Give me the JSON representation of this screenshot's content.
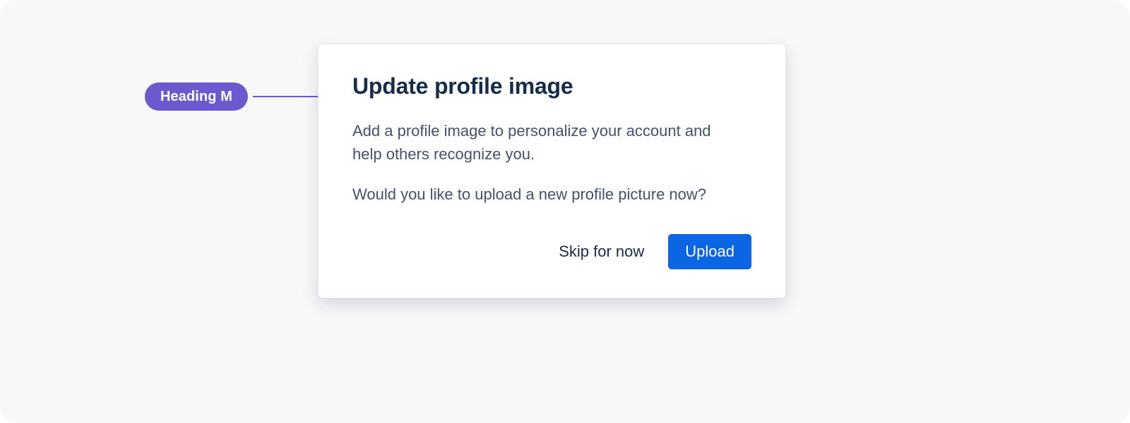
{
  "annotation": {
    "label": "Heading M"
  },
  "dialog": {
    "title": "Update profile image",
    "body1": "Add a profile image to personalize your account and help others recognize you.",
    "body2": "Would you like to upload a new profile picture now?",
    "actions": {
      "skip": "Skip for now",
      "upload": "Upload"
    }
  }
}
